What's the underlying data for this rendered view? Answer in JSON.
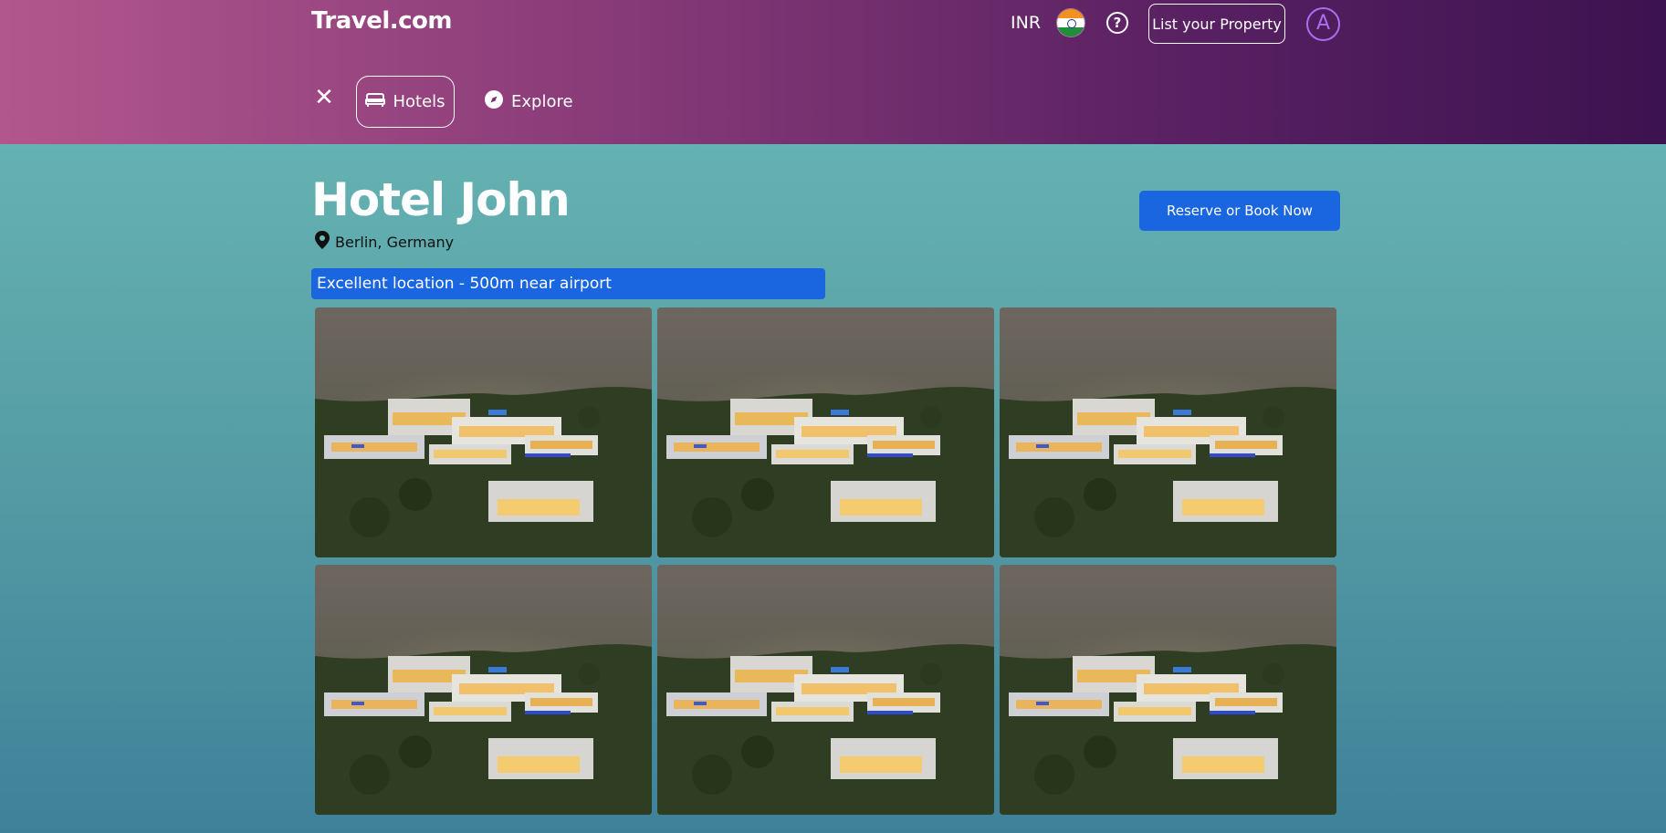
{
  "header": {
    "brand": "Travel.com",
    "currency": "INR",
    "flag_icon": "india-flag-icon",
    "help_icon": "help-circle-icon",
    "list_property_label": "List your Property",
    "avatar_letter": "A"
  },
  "nav": {
    "close_icon": "close-icon",
    "tabs": [
      {
        "label": "Hotels",
        "icon": "bed-icon",
        "active": true
      },
      {
        "label": "Explore",
        "icon": "compass-icon",
        "active": false
      }
    ]
  },
  "hotel": {
    "name": "Hotel John",
    "location": "Berlin, Germany",
    "location_icon": "map-pin-icon",
    "reserve_label": "Reserve or Book Now",
    "highlight": "Excellent location - 500m near airport"
  },
  "gallery": {
    "photos": [
      {
        "alt": "hotel-photo"
      },
      {
        "alt": "hotel-photo"
      },
      {
        "alt": "hotel-photo"
      },
      {
        "alt": "hotel-photo"
      },
      {
        "alt": "hotel-photo"
      },
      {
        "alt": "hotel-photo"
      }
    ]
  },
  "colors": {
    "header_gradient_start": "#b2578d",
    "header_gradient_end": "#3c124f",
    "primary_button": "#1a66e0",
    "avatar_accent": "#a66ff0"
  }
}
